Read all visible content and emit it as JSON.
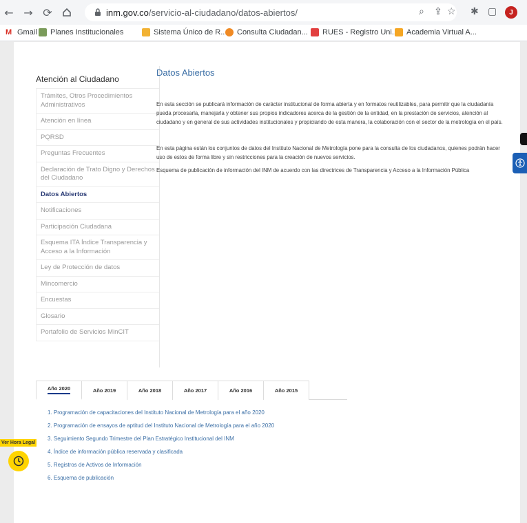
{
  "browser": {
    "url_domain": "inm.gov.co",
    "url_path": "/servicio-al-ciudadano/datos-abiertos/",
    "avatar_letter": "J",
    "bookmarks": [
      {
        "label": "Gmail",
        "icon": "gmail-icon",
        "color": "#d93025"
      },
      {
        "label": "Planes Institucionales",
        "icon": "planes-icon",
        "color": "#7a9b5a"
      },
      {
        "label": "Sistema Único de R...",
        "icon": "folder-icon",
        "color": "#f2b233"
      },
      {
        "label": "Consulta Ciudadan...",
        "icon": "consulta-icon",
        "color": "#f08a24"
      },
      {
        "label": "RUES - Registro Uni...",
        "icon": "rues-icon",
        "color": "#e23f3f"
      },
      {
        "label": "Academia Virtual A...",
        "icon": "academia-icon",
        "color": "#f5a623"
      }
    ]
  },
  "sidebar": {
    "title": "Atención al Ciudadano",
    "items": [
      {
        "label": "Trámites, Otros Procedimientos Administrativos",
        "active": false
      },
      {
        "label": "Atención en línea",
        "active": false
      },
      {
        "label": "PQRSD",
        "active": false
      },
      {
        "label": "Preguntas Frecuentes",
        "active": false
      },
      {
        "label": "Declaración de Trato Digno y Derechos del Ciudadano",
        "active": false
      },
      {
        "label": "Datos Abiertos",
        "active": true
      },
      {
        "label": "Notificaciones",
        "active": false
      },
      {
        "label": "Participación Ciudadana",
        "active": false
      },
      {
        "label": "Esquema ITA Índice Transparencia y Acceso a la Información",
        "active": false
      },
      {
        "label": "Ley de Protección de datos",
        "active": false
      },
      {
        "label": "Mincomercio",
        "active": false
      },
      {
        "label": "Encuestas",
        "active": false
      },
      {
        "label": "Glosario",
        "active": false
      },
      {
        "label": "Portafolio de Servicios MinCIT",
        "active": false
      }
    ]
  },
  "main": {
    "title": "Datos Abiertos",
    "paragraphs": [
      "En esta sección se publicará información de carácter institucional de forma abierta y en formatos reutilizables, para permitir que la ciudadanía pueda procesarla, manejarla y obtener sus propios indicadores acerca de la gestión de la entidad, en la prestación de servicios, atención al ciudadano y en general de sus actividades institucionales y propiciando de esta manera, la colaboración con el sector de la metrología en el país.",
      "En esta página están los conjuntos de datos del Instituto Nacional de Metrología pone para la consulta de los ciudadanos, quienes podrán hacer uso de estos de forma libre y sin restricciones para la creación de nuevos servicios.",
      "Esquema de publicación de información del INM de acuerdo con las directrices de Transparencia y Acceso a la Información Pública"
    ]
  },
  "tabs": [
    "Año 2020",
    "Año 2019",
    "Año 2018",
    "Año 2017",
    "Año 2016",
    "Año 2015"
  ],
  "documents": [
    "1. Programación de capacitaciones del Instituto Nacional de Metrología para el año 2020",
    "2. Programación de ensayos de aptitud del Instituto Nacional de Metrología para el año 2020",
    "3. Seguimiento Segundo Trimestre del Plan Estratégico Institucional del INM",
    "4. Índice de información pública reservada y clasificada",
    "5. Registros de Activos de Información",
    "6. Esquema de publicación"
  ],
  "widgets": {
    "hora_legal": "Ver Hora Legal"
  },
  "colors": {
    "accent_blue": "#3a6ea5",
    "active_nav": "#2a3b75",
    "hora_yellow": "#ffd400",
    "accessibility_blue": "#1b5fb5"
  }
}
